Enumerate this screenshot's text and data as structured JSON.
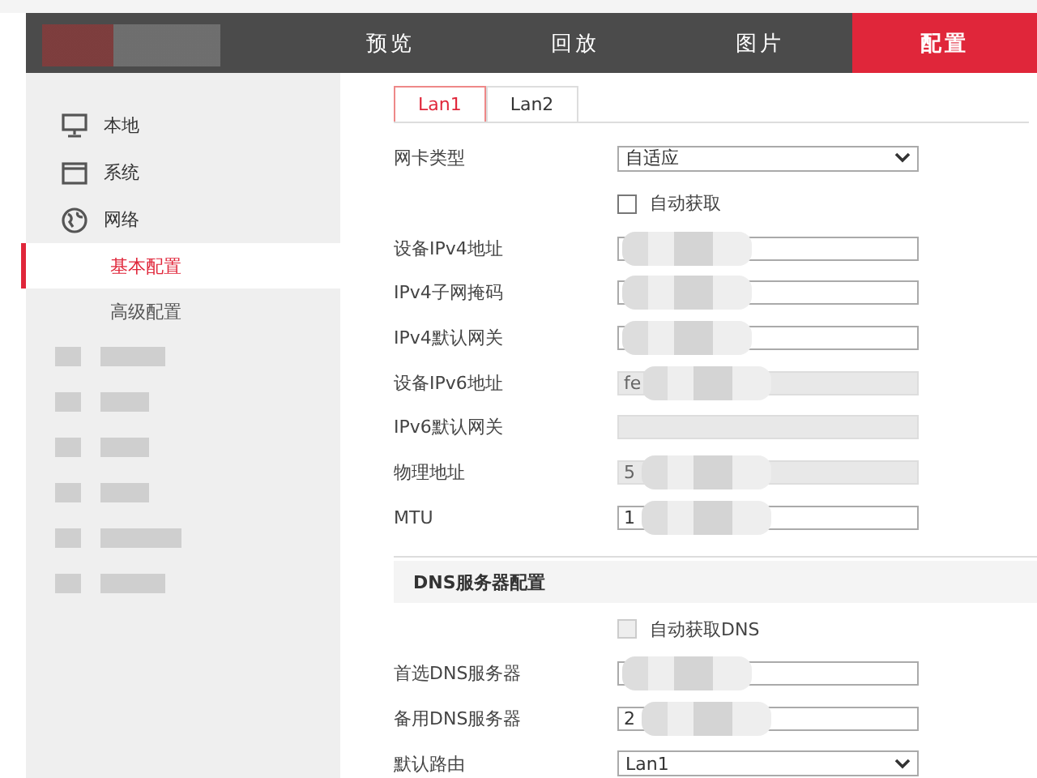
{
  "header": {
    "nav": [
      {
        "label": "预览",
        "selected": false
      },
      {
        "label": "回放",
        "selected": false
      },
      {
        "label": "图片",
        "selected": false
      },
      {
        "label": "配置",
        "selected": true
      }
    ]
  },
  "sidebar": {
    "items": [
      {
        "label": "本地"
      },
      {
        "label": "系统"
      },
      {
        "label": "网络",
        "children": [
          {
            "label": "基本配置",
            "selected": true
          },
          {
            "label": "高级配置",
            "selected": false
          }
        ]
      }
    ]
  },
  "tabs": [
    {
      "label": "Lan1",
      "selected": true
    },
    {
      "label": "Lan2",
      "selected": false
    }
  ],
  "rows": [
    {
      "kind": "select",
      "label": "网卡类型",
      "value": "自适应"
    },
    {
      "kind": "checkbox",
      "label": "自动获取",
      "checked": false,
      "disabled": false
    },
    {
      "kind": "input",
      "label": "设备IPv4地址",
      "disabled": false,
      "redacted": true
    },
    {
      "kind": "input",
      "label": "IPv4子网掩码",
      "disabled": false,
      "redacted": true
    },
    {
      "kind": "input",
      "label": "IPv4默认网关",
      "disabled": false,
      "redacted": true
    },
    {
      "kind": "input",
      "label": "设备IPv6地址",
      "value": "fe",
      "disabled": true,
      "redacted": true
    },
    {
      "kind": "input",
      "label": "IPv6默认网关",
      "disabled": true
    },
    {
      "kind": "input",
      "label": "物理地址",
      "value": "5",
      "disabled": true,
      "redacted": true
    },
    {
      "kind": "input",
      "label": "MTU",
      "value": "1",
      "disabled": false,
      "redacted": true
    }
  ],
  "dns": {
    "title": "DNS服务器配置",
    "rows": [
      {
        "kind": "checkbox",
        "label": "自动获取DNS",
        "checked": false,
        "disabled": true
      },
      {
        "kind": "input",
        "label": "首选DNS服务器",
        "disabled": false,
        "redacted": true
      },
      {
        "kind": "input",
        "label": "备用DNS服务器",
        "value": "2",
        "disabled": false,
        "redacted": true
      },
      {
        "kind": "select",
        "label": "默认路由",
        "value": "Lan1"
      }
    ]
  }
}
